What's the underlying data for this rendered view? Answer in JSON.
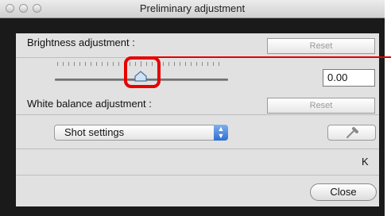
{
  "window": {
    "title": "Preliminary adjustment"
  },
  "brightness": {
    "label": "Brightness adjustment :",
    "reset_label": "Reset",
    "value": "0.00",
    "slider_level": 0.5
  },
  "white_balance": {
    "label": "White balance adjustment :",
    "reset_label": "Reset",
    "select_value": "Shot settings",
    "unit": "K"
  },
  "footer": {
    "close_label": "Close"
  },
  "icons": {
    "close": "close-traffic-light",
    "minimize": "minimize-traffic-light",
    "zoom": "zoom-traffic-light",
    "eyedropper": "eyedropper-icon",
    "thumb": "slider-thumb"
  },
  "colors": {
    "annotation": "#e60000",
    "select_accent": "#2d6fd3"
  }
}
